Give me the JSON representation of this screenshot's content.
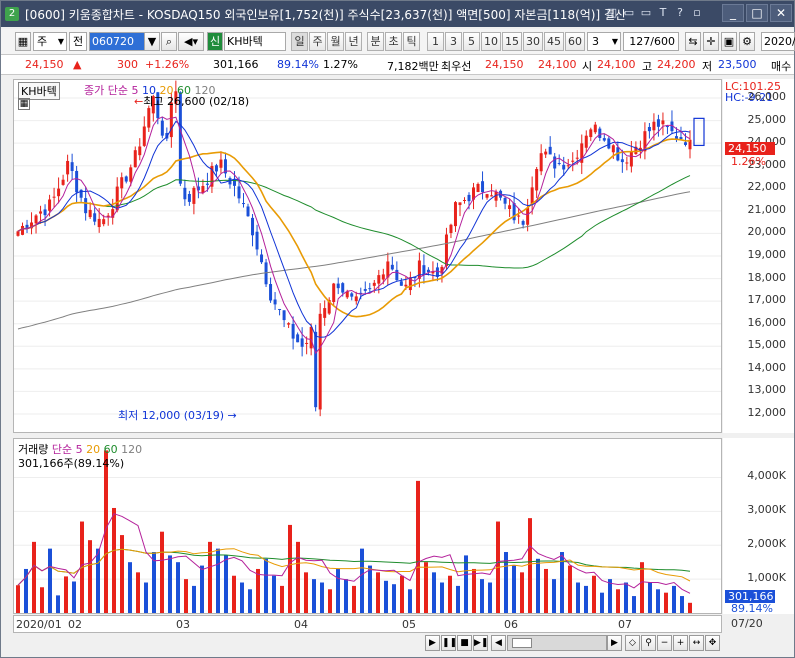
{
  "window": {
    "number_badge": "2",
    "title": "[0600] 키움종합차트 - KOSDAQ150 외국인보유[1,752(천)] 주식수[23,637(천)] 액면[500] 자본금[118(억)] 결산",
    "controls": [
      "_",
      "□",
      "✕"
    ],
    "title_icons": [
      "◱",
      "▭",
      "▭",
      "T",
      "?",
      "▫"
    ]
  },
  "toolbar": {
    "market_label": "주",
    "period_label": "전",
    "code": "060720",
    "sin_label": "신",
    "stock_name": "KH바텍",
    "tabs": [
      "일",
      "주",
      "월",
      "년",
      "분",
      "초",
      "틱"
    ],
    "intervals": [
      "1",
      "3",
      "5",
      "10",
      "15",
      "30",
      "45",
      "60"
    ],
    "selected_count": "3",
    "range": "127/600",
    "date": "2020/"
  },
  "quote": {
    "price": "24,150",
    "arrow": "▲",
    "change": "300",
    "change_pct": "+1.26%",
    "volume": "301,166",
    "vol_pct": "89.14%",
    "turnover": "1.27%",
    "amount": "7,182백만",
    "best_ask_label": "최우선",
    "best_ask": "24,150",
    "best_bid": "24,100",
    "open_label": "시",
    "open": "24,100",
    "high_label": "고",
    "high": "24,200",
    "low_label": "저",
    "low": "23,500",
    "extra": "매수"
  },
  "price_chart": {
    "stock_tag": "KH바텍",
    "legend_prefix": "종가 단순",
    "ma": [
      {
        "period": "5",
        "color": "#b4219b"
      },
      {
        "period": "10",
        "color": "#1034d6"
      },
      {
        "period": "20",
        "color": "#e89b05"
      },
      {
        "period": "60",
        "color": "#1e8c2c"
      },
      {
        "period": "120",
        "color": "#808080"
      }
    ],
    "high_note": "최고 26,600 (02/18)",
    "low_note": "최저 12,000 (03/19)",
    "lc": "LC:101.25",
    "hc": "HC:-9.21",
    "cur_price": "24,150",
    "cur_pct": "1.26%"
  },
  "volume_chart": {
    "legend_title": "거래량",
    "legend_prefix": "단순",
    "ma": [
      {
        "period": "5",
        "color": "#b4219b"
      },
      {
        "period": "20",
        "color": "#e89b05"
      },
      {
        "period": "60",
        "color": "#1e8c2c"
      },
      {
        "period": "120",
        "color": "#808080"
      }
    ],
    "current_label": "301,166주(89.14%)",
    "cur_volume": "301,166",
    "cur_pct": "89.14%"
  },
  "x_axis": [
    "2020/01",
    "02",
    "03",
    "04",
    "05",
    "06",
    "07",
    "07/20"
  ],
  "chart_data": {
    "type": "candlestick",
    "y_ticks": [
      26000,
      25000,
      24000,
      23000,
      22000,
      21000,
      20000,
      19000,
      18000,
      17000,
      16000,
      15000,
      14000,
      13000,
      12000
    ],
    "y_tick_labels": [
      "26,000",
      "25,000",
      "24,000",
      "23,000",
      "22,000",
      "21,000",
      "20,000",
      "19,000",
      "18,000",
      "17,000",
      "16,000",
      "15,000",
      "14,000",
      "13,000",
      "12,000"
    ],
    "ylim": [
      11200,
      26800
    ],
    "vol_ticks": [
      4000,
      3000,
      2000,
      1000
    ],
    "vol_tick_labels": [
      "4,000K",
      "3,000K",
      "2,000K",
      "1,000K"
    ],
    "vol_ylim": [
      0,
      4900
    ],
    "ohlc_anchors": [
      [
        20400,
        20100
      ],
      [
        21200,
        20800
      ],
      [
        21000,
        21300
      ],
      [
        22800,
        23100
      ],
      [
        21600,
        21100
      ],
      [
        20600,
        20500
      ],
      [
        21800,
        21900
      ],
      [
        22800,
        23400
      ],
      [
        25500,
        26100
      ],
      [
        23800,
        23500
      ],
      [
        21700,
        21500
      ],
      [
        21400,
        22200
      ],
      [
        22800,
        23100
      ],
      [
        21800,
        21900
      ],
      [
        20500,
        20100
      ],
      [
        18400,
        17400
      ],
      [
        16200,
        15800
      ],
      [
        13200,
        14900
      ],
      [
        15700,
        16500
      ],
      [
        17600,
        17900
      ],
      [
        17000,
        16800
      ],
      [
        16900,
        17400
      ],
      [
        18700,
        18900
      ],
      [
        18000,
        17500
      ],
      [
        18100,
        18600
      ],
      [
        18200,
        18100
      ],
      [
        20100,
        21100
      ],
      [
        21300,
        21800
      ],
      [
        21900,
        22100
      ],
      [
        21700,
        21200
      ],
      [
        21000,
        20400
      ],
      [
        23000,
        23600
      ],
      [
        23400,
        23100
      ],
      [
        22600,
        23200
      ],
      [
        24500,
        24800
      ],
      [
        24000,
        24300
      ],
      [
        23300,
        23200
      ],
      [
        23800,
        24100
      ],
      [
        24700,
        24900
      ],
      [
        23700,
        24400
      ],
      [
        24150,
        24150
      ]
    ],
    "volume_k": [
      820,
      1300,
      2100,
      760,
      1900,
      520,
      1080,
      930,
      2700,
      2150,
      1900,
      4800,
      3100,
      2300,
      1500,
      1200,
      900,
      1800,
      2400,
      1700,
      1500,
      1000,
      800,
      1400,
      2100,
      1900,
      1700,
      1100,
      900,
      700,
      1300,
      1600,
      1100,
      800,
      2600,
      2100,
      1200,
      1000,
      900,
      700,
      1300,
      1000,
      800,
      1900,
      1400,
      1200,
      950,
      850,
      1100,
      700,
      3900,
      1500,
      1200,
      900,
      1100,
      800,
      1700,
      1300,
      1000,
      900,
      2700,
      1800,
      1400,
      1200,
      2800,
      1600,
      1300,
      1000,
      1800,
      1400,
      900,
      800,
      1100,
      600,
      1000,
      700,
      900,
      500,
      1500,
      900,
      700,
      600,
      800,
      500,
      301
    ]
  }
}
